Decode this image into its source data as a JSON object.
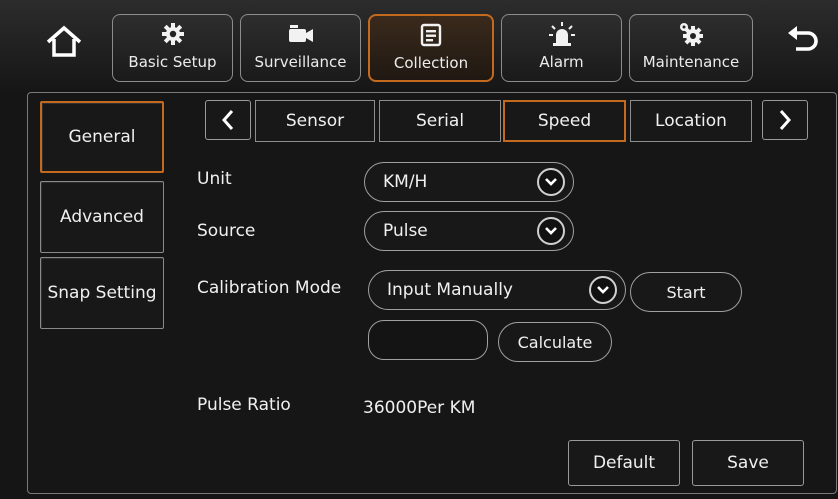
{
  "top_tabs": [
    {
      "label": "Basic Setup",
      "icon": "gear-icon"
    },
    {
      "label": "Surveillance",
      "icon": "camera-icon"
    },
    {
      "label": "Collection",
      "icon": "document-icon"
    },
    {
      "label": "Alarm",
      "icon": "alarm-light-icon"
    },
    {
      "label": "Maintenance",
      "icon": "maintenance-gear-icon"
    }
  ],
  "active_top_tab": "Collection",
  "side_menu": [
    {
      "label": "General"
    },
    {
      "label": "Advanced"
    },
    {
      "label": "Snap Setting"
    }
  ],
  "active_side_item": "General",
  "sub_tabs": [
    {
      "label": "Sensor"
    },
    {
      "label": "Serial"
    },
    {
      "label": "Speed"
    },
    {
      "label": "Location"
    }
  ],
  "active_sub_tab": "Speed",
  "form": {
    "unit_label": "Unit",
    "unit_value": "KM/H",
    "source_label": "Source",
    "source_value": "Pulse",
    "calibration_label": "Calibration Mode",
    "calibration_value": "Input Manually",
    "start_label": "Start",
    "calibration_input_value": "",
    "calculate_label": "Calculate",
    "pulse_ratio_label": "Pulse Ratio",
    "pulse_ratio_value": "36000Per KM"
  },
  "footer": {
    "default_label": "Default",
    "save_label": "Save"
  },
  "colors": {
    "accent": "#c36a1e",
    "background": "#151515",
    "border": "#8c8c8c"
  }
}
